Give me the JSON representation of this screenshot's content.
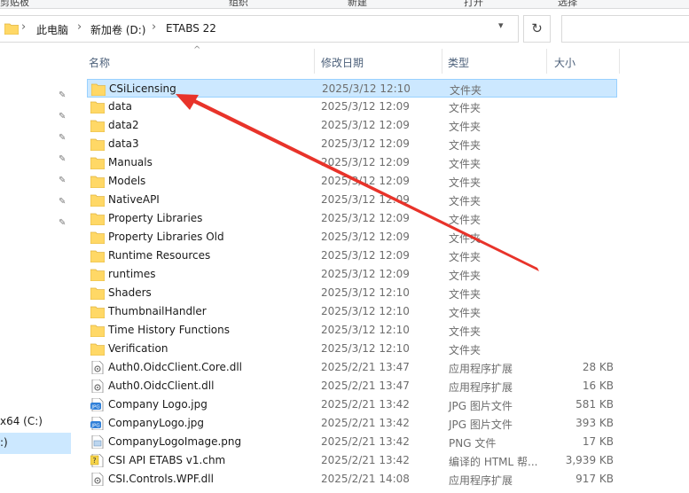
{
  "ribbon": {
    "clipboard": "剪贴板",
    "organize": "组织",
    "new": "新建",
    "open": "打开",
    "select": "选择"
  },
  "breadcrumb": {
    "items": [
      "此电脑",
      "新加卷 (D:)",
      "ETABS 22"
    ]
  },
  "columns": {
    "name": "名称",
    "date": "修改日期",
    "type": "类型",
    "size": "大小"
  },
  "nav": {
    "drive_c": "x64 (C:)",
    "drive_sel": ":)"
  },
  "files": [
    {
      "name": "CSiLicensing",
      "date": "2025/3/12 12:10",
      "type": "文件夹",
      "size": "",
      "icon": "folder-icon",
      "selected": true
    },
    {
      "name": "data",
      "date": "2025/3/12 12:09",
      "type": "文件夹",
      "size": "",
      "icon": "folder-icon"
    },
    {
      "name": "data2",
      "date": "2025/3/12 12:09",
      "type": "文件夹",
      "size": "",
      "icon": "folder-icon"
    },
    {
      "name": "data3",
      "date": "2025/3/12 12:09",
      "type": "文件夹",
      "size": "",
      "icon": "folder-icon"
    },
    {
      "name": "Manuals",
      "date": "2025/3/12 12:09",
      "type": "文件夹",
      "size": "",
      "icon": "folder-icon"
    },
    {
      "name": "Models",
      "date": "2025/3/12 12:09",
      "type": "文件夹",
      "size": "",
      "icon": "folder-icon"
    },
    {
      "name": "NativeAPI",
      "date": "2025/3/12 12:09",
      "type": "文件夹",
      "size": "",
      "icon": "folder-icon"
    },
    {
      "name": "Property Libraries",
      "date": "2025/3/12 12:09",
      "type": "文件夹",
      "size": "",
      "icon": "folder-icon"
    },
    {
      "name": "Property Libraries Old",
      "date": "2025/3/12 12:09",
      "type": "文件夹",
      "size": "",
      "icon": "folder-icon"
    },
    {
      "name": "Runtime Resources",
      "date": "2025/3/12 12:09",
      "type": "文件夹",
      "size": "",
      "icon": "folder-icon"
    },
    {
      "name": "runtimes",
      "date": "2025/3/12 12:09",
      "type": "文件夹",
      "size": "",
      "icon": "folder-icon"
    },
    {
      "name": "Shaders",
      "date": "2025/3/12 12:10",
      "type": "文件夹",
      "size": "",
      "icon": "folder-icon"
    },
    {
      "name": "ThumbnailHandler",
      "date": "2025/3/12 12:10",
      "type": "文件夹",
      "size": "",
      "icon": "folder-icon"
    },
    {
      "name": "Time History Functions",
      "date": "2025/3/12 12:10",
      "type": "文件夹",
      "size": "",
      "icon": "folder-icon"
    },
    {
      "name": "Verification",
      "date": "2025/3/12 12:10",
      "type": "文件夹",
      "size": "",
      "icon": "folder-icon"
    },
    {
      "name": "Auth0.OidcClient.Core.dll",
      "date": "2025/2/21 13:47",
      "type": "应用程序扩展",
      "size": "28 KB",
      "icon": "dll-icon"
    },
    {
      "name": "Auth0.OidcClient.dll",
      "date": "2025/2/21 13:47",
      "type": "应用程序扩展",
      "size": "16 KB",
      "icon": "dll-icon"
    },
    {
      "name": "Company Logo.jpg",
      "date": "2025/2/21 13:42",
      "type": "JPG 图片文件",
      "size": "581 KB",
      "icon": "jpg-icon"
    },
    {
      "name": "CompanyLogo.jpg",
      "date": "2025/2/21 13:42",
      "type": "JPG 图片文件",
      "size": "393 KB",
      "icon": "jpg-icon"
    },
    {
      "name": "CompanyLogoImage.png",
      "date": "2025/2/21 13:42",
      "type": "PNG 文件",
      "size": "17 KB",
      "icon": "png-icon"
    },
    {
      "name": "CSI API ETABS v1.chm",
      "date": "2025/2/21 13:42",
      "type": "编译的 HTML 帮...",
      "size": "3,939 KB",
      "icon": "chm-icon"
    },
    {
      "name": "CSI.Controls.WPF.dll",
      "date": "2025/2/21 14:08",
      "type": "应用程序扩展",
      "size": "917 KB",
      "icon": "dll-icon"
    }
  ],
  "colors": {
    "folder": "#ffd866",
    "selection": "#cce8ff",
    "selection_border": "#99d1ff",
    "arrow": "#e8332a"
  }
}
